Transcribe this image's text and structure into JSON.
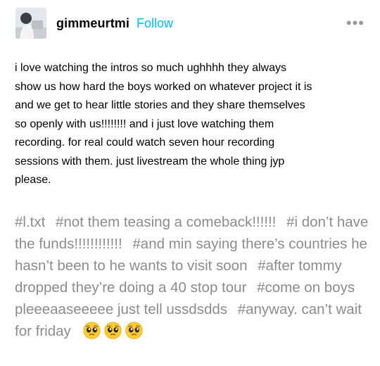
{
  "post": {
    "username": "gimmeurtmi",
    "follow_label": "Follow",
    "more_icon": "•••",
    "body": "i love watching the intros so much ughhhh they always\nshow us how hard the boys worked on whatever project it is\nand we get to hear little stories and they share themselves\nso openly with us!!!!!!!! and i just love watching them\nrecording. for real could watch seven hour recording\nsessions with them. just livestream the whole thing jyp\nplease.",
    "tags": [
      "#l.txt",
      "#not them teasing a comeback!!!!!!",
      "#i don’t have the funds!!!!!!!!!!!!",
      "#and min saying there’s countries he hasn’t been to he wants to visit soon",
      "#after tommy dropped they’re doing a 40 stop tour",
      "#come on boys pleeeaaseeeee just tell ussdsdds",
      "#anyway. can’t wait for friday"
    ],
    "emojis": [
      "pleading-face",
      "pleading-face",
      "pleading-face"
    ]
  },
  "colors": {
    "follow": "#00b8ff",
    "tag_text": "#8c8c8c",
    "body_text": "#000000",
    "more_icon": "#999999"
  }
}
